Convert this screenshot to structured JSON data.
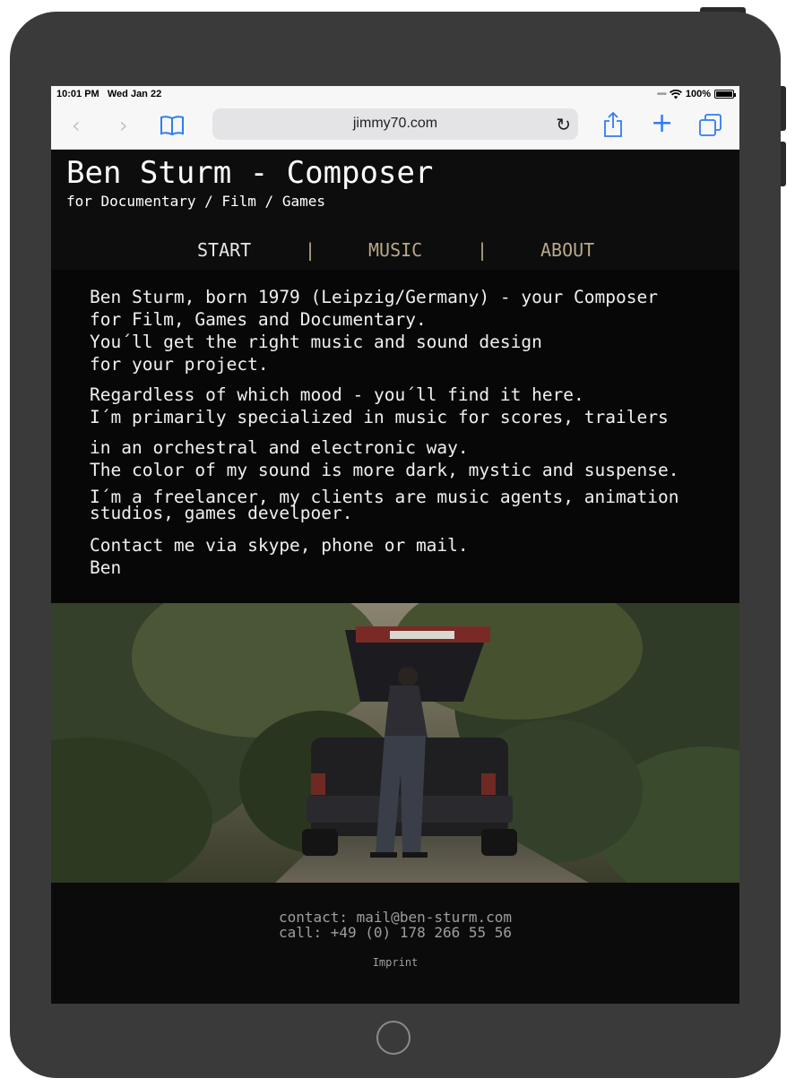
{
  "status_bar": {
    "time": "10:01 PM",
    "date": "Wed Jan 22",
    "battery": "100%"
  },
  "browser": {
    "url": "jimmy70.com"
  },
  "site": {
    "title": "Ben Sturm - Composer",
    "subtitle": "for Documentary / Film / Games",
    "nav": {
      "start": "START",
      "music": "MUSIC",
      "about": "ABOUT",
      "separator": "|"
    },
    "content": {
      "p1_line1": "Ben Sturm, born 1979 (Leipzig/Germany) - your Composer",
      "p1_line2": "for Film, Games and Documentary.",
      "p1_line3": "You´ll get the right music and sound design",
      "p1_line4": "for your project.",
      "p2_line1": "Regardless of which mood - you´ll find it here.",
      "p2_line2": "I´m primarily specialized in music for scores, trailers",
      "p3_line1": "in an orchestral and electronic way.",
      "p3_line2": "The color of my sound is more dark, mystic and suspense.",
      "p4_line1": "I´m a freelancer, my clients are music agents, animation",
      "p4_line2": "studios, games develpoer.",
      "p5_line1": "Contact me via skype, phone or mail.",
      "p5_line2": "Ben"
    },
    "footer": {
      "contact": "contact: mail@ben-sturm.com",
      "call": "call: +49 (0) 178 266 55 56",
      "imprint": "Imprint"
    }
  },
  "colors": {
    "nav_active": "#e6e6e6",
    "nav_link": "#b9a888",
    "page_bg": "#070707",
    "safari_blue": "#2f7cf6"
  }
}
